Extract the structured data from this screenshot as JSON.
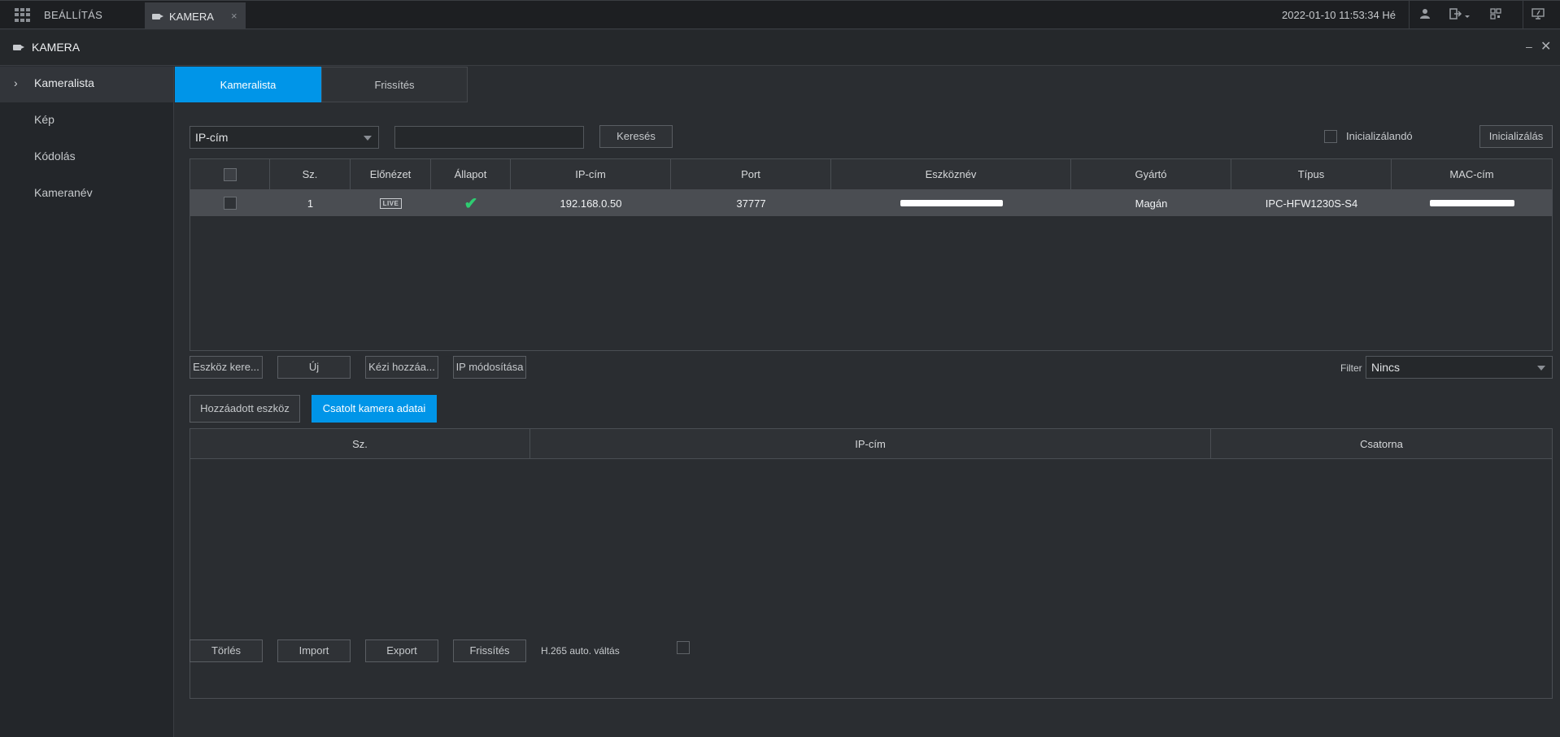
{
  "topbar": {
    "home_label": "BEÁLLÍTÁS",
    "tab_label": "KAMERA",
    "tab_close": "×",
    "datetime": "2022-01-10 11:53:34 Hé"
  },
  "panel": {
    "title": "KAMERA",
    "minimize": "–",
    "close": "✕"
  },
  "sidebar": {
    "items": [
      {
        "label": "Kameralista",
        "active": true
      },
      {
        "label": "Kép"
      },
      {
        "label": "Kódolás"
      },
      {
        "label": "Kameranév"
      }
    ]
  },
  "tabs": [
    {
      "label": "Kameralista"
    },
    {
      "label": "Frissítés"
    }
  ],
  "search": {
    "field_select": "IP-cím",
    "query": "",
    "search_button": "Keresés",
    "init_checkbox_label": "Inicializálandó",
    "init_button": "Inicializálás"
  },
  "device_table": {
    "columns": [
      "",
      "Sz.",
      "Előnézet",
      "Állapot",
      "IP-cím",
      "Port",
      "Eszköznév",
      "Gyártó",
      "Típus",
      "MAC-cím"
    ],
    "rows": [
      {
        "no": "1",
        "preview": "LIVE",
        "ip": "192.168.0.50",
        "port": "37777",
        "name": "",
        "vendor": "Magán",
        "type": "IPC-HFW1230S-S4",
        "mac": ""
      }
    ]
  },
  "device_actions": {
    "search_device": "Eszköz kere...",
    "new": "Új",
    "manual_add": "Kézi hozzáa...",
    "ip_modify": "IP módosítása",
    "filter_label": "Filter",
    "filter_value": "Nincs"
  },
  "subtabs": {
    "added": "Hozzáadott eszköz",
    "linked": "Csatolt kamera adatai"
  },
  "linked_table": {
    "columns": [
      "Sz.",
      "IP-cím",
      "Csatorna"
    ]
  },
  "bottom_actions": {
    "delete": "Törlés",
    "import": "Import",
    "export": "Export",
    "refresh": "Frissítés",
    "h265_label": "H.265 auto. váltás"
  },
  "colors": {
    "accent": "#0095e8",
    "status_ok": "#2ecc71"
  }
}
